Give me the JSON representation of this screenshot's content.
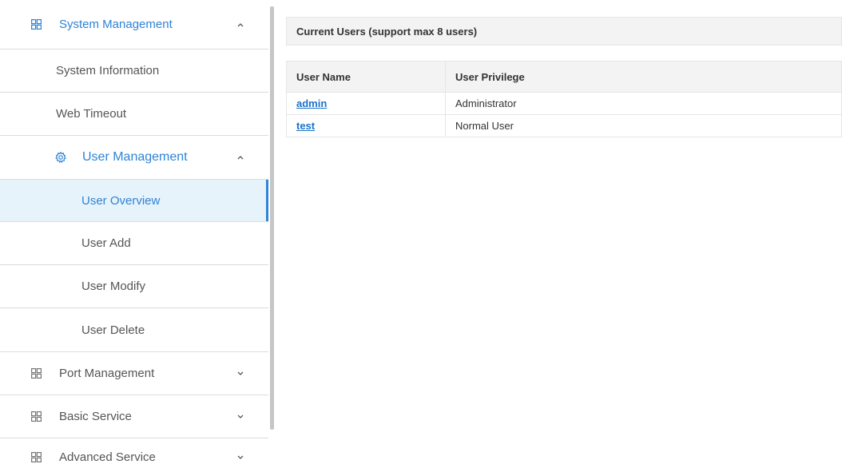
{
  "sidebar": {
    "system_management": {
      "label": "System Management",
      "icon": "grid-icon",
      "expanded": true
    },
    "system_information": {
      "label": "System Information"
    },
    "web_timeout": {
      "label": "Web Timeout"
    },
    "user_management": {
      "label": "User Management",
      "icon": "gear-icon",
      "expanded": true
    },
    "user_overview": {
      "label": "User Overview",
      "selected": true
    },
    "user_add": {
      "label": "User Add"
    },
    "user_modify": {
      "label": "User Modify"
    },
    "user_delete": {
      "label": "User Delete"
    },
    "port_management": {
      "label": "Port Management",
      "icon": "grid-icon",
      "expanded": false
    },
    "basic_service": {
      "label": "Basic Service",
      "icon": "grid-icon",
      "expanded": false
    },
    "advanced_service": {
      "label": "Advanced Service",
      "icon": "grid-icon",
      "expanded": false
    }
  },
  "main": {
    "section_title": "Current Users (support max 8 users)",
    "table": {
      "columns": [
        "User Name",
        "User Privilege"
      ],
      "rows": [
        {
          "name": "admin",
          "privilege": "Administrator"
        },
        {
          "name": "test",
          "privilege": "Normal User"
        }
      ]
    }
  },
  "colors": {
    "accent": "#2f83d6",
    "selected_bg": "#e7f3fb",
    "header_bg": "#f3f3f3",
    "link": "#1a73c9"
  }
}
